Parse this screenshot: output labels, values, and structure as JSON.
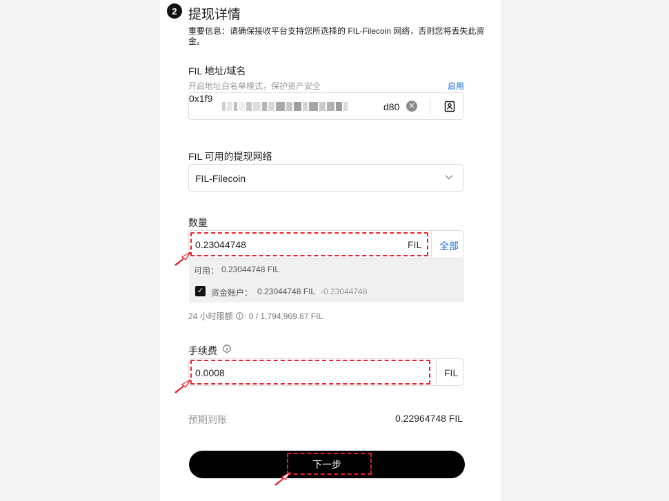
{
  "step": {
    "number": "2",
    "title": "提现详情",
    "notice": "重要信息：请确保接收平台支持您所选择的 FIL-Filecoin 网络，否则您将丢失此资金。"
  },
  "address": {
    "label": "FIL 地址/域名",
    "whitelist_hint": "开启地址白名单模式，保护资产安全",
    "enable_link": "启用",
    "value_head": "0x1f9",
    "value_tail": "d80",
    "clear_icon": "close-circle-icon",
    "book_icon": "address-book-icon"
  },
  "network": {
    "label": "FIL 可用的提现网络",
    "selected": "FIL-Filecoin",
    "dropdown_icon": "chevron-down-icon"
  },
  "amount": {
    "label": "数量",
    "value": "0.23044748",
    "unit": "FIL",
    "max_label": "全部",
    "available_label": "可用：",
    "available_value": "0.23044748 FIL",
    "funding_account_label": "资金账户：",
    "funding_account_value": "0.23044748 FIL",
    "funding_account_deduct": "-0.23044748",
    "checkbox_checked": true,
    "limit_prefix": "24 小时限额",
    "limit_value": ": 0 / 1,794,969.67 FIL"
  },
  "fee": {
    "label": "手续费",
    "value": "0.0008",
    "unit": "FIL",
    "info_icon": "info-icon"
  },
  "expected": {
    "label": "预期到账",
    "value": "0.22964748 FIL"
  },
  "next_button": {
    "label": "下一步"
  },
  "colors": {
    "accent_link": "#1a6fe0",
    "annotation_red": "#e8202c",
    "button_bg": "#000000"
  }
}
